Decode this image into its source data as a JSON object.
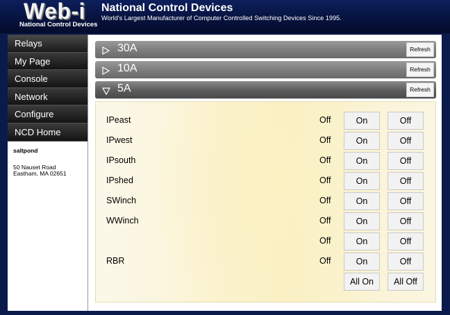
{
  "header": {
    "logo_text": "Web-i",
    "logo_subtitle": "National Control Devices",
    "brand_title": "National Control Devices",
    "brand_tagline": "World's Largest Manufacturer of Computer Controlled Switching Devices Since 1995."
  },
  "sidebar": {
    "items": [
      {
        "label": "Relays",
        "active": true
      },
      {
        "label": "My Page"
      },
      {
        "label": "Console"
      },
      {
        "label": "Network"
      },
      {
        "label": "Configure"
      },
      {
        "label": "NCD Home"
      }
    ],
    "site_name": "saltpond",
    "address_line1": "50 Nauset Road",
    "address_line2": "Eastham, MA 02651"
  },
  "groups": [
    {
      "label": "30A",
      "state": "collapsed",
      "refresh_label": "Refresh"
    },
    {
      "label": "10A",
      "state": "collapsed",
      "refresh_label": "Refresh"
    },
    {
      "label": "5A",
      "state": "expanded",
      "refresh_label": "Refresh"
    }
  ],
  "relays": [
    {
      "name": "IPeast",
      "status": "Off",
      "on_label": "On",
      "off_label": "Off"
    },
    {
      "name": "IPwest",
      "status": "Off",
      "on_label": "On",
      "off_label": "Off"
    },
    {
      "name": "IPsouth",
      "status": "Off",
      "on_label": "On",
      "off_label": "Off"
    },
    {
      "name": "IPshed",
      "status": "Off",
      "on_label": "On",
      "off_label": "Off"
    },
    {
      "name": "SWinch",
      "status": "Off",
      "on_label": "On",
      "off_label": "Off"
    },
    {
      "name": "WWinch",
      "status": "Off",
      "on_label": "On",
      "off_label": "Off"
    },
    {
      "name": "",
      "status": "Off",
      "on_label": "On",
      "off_label": "Off"
    },
    {
      "name": "RBR",
      "status": "Off",
      "on_label": "On",
      "off_label": "Off"
    }
  ],
  "all_controls": {
    "all_on_label": "All On",
    "all_off_label": "All Off"
  },
  "colors": {
    "header_bg": "#06123d",
    "nav_bg": "#1e1e1e",
    "panel_bg": "#fbf3d2",
    "group_bar": "#7e7e7e"
  }
}
